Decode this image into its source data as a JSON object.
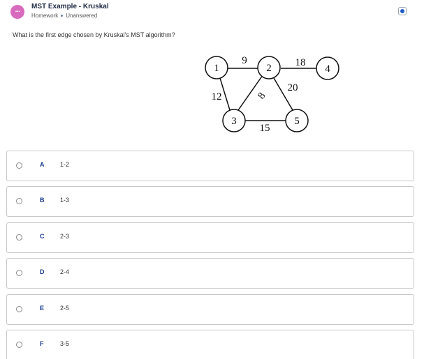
{
  "header": {
    "title": "MST Example - Kruskal",
    "category": "Homework",
    "status": "Unanswered",
    "avatar_icon": "more-dots-icon",
    "accent_color": "#d86bbd"
  },
  "question": {
    "text": "What is the first edge chosen by Kruskal's MST algorithm?"
  },
  "graph": {
    "nodes": [
      "1",
      "2",
      "3",
      "4",
      "5"
    ],
    "edge_weights": {
      "e12": "9",
      "e13": "12",
      "e23": "8",
      "e24": "18",
      "e25": "20",
      "e35": "15"
    }
  },
  "options": [
    {
      "letter": "A",
      "text": "1-2"
    },
    {
      "letter": "B",
      "text": "1-3"
    },
    {
      "letter": "C",
      "text": "2-3"
    },
    {
      "letter": "D",
      "text": "2-4"
    },
    {
      "letter": "E",
      "text": "2-5"
    },
    {
      "letter": "F",
      "text": "3-5"
    }
  ]
}
